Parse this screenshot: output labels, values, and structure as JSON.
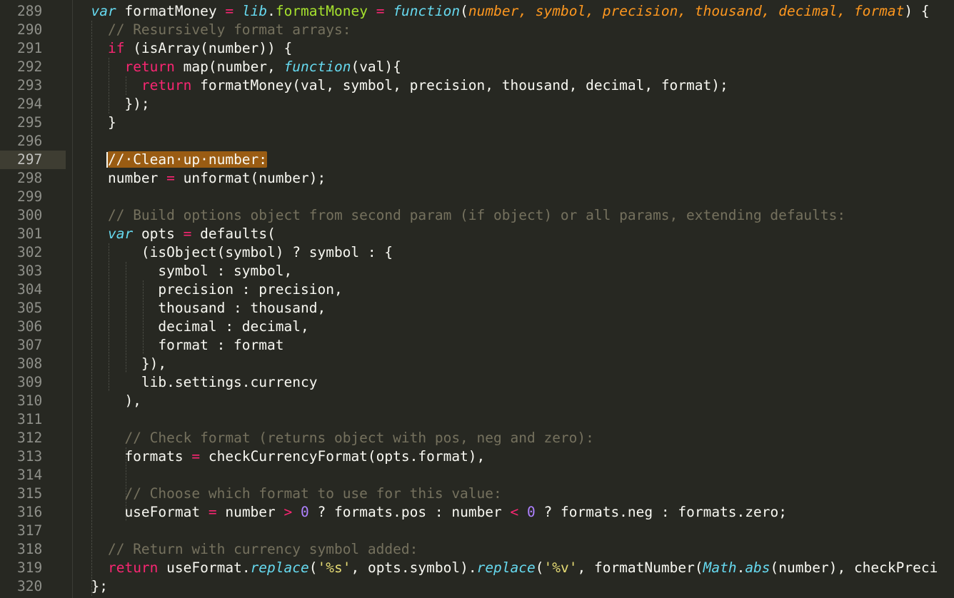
{
  "editor": {
    "active_line": "297",
    "colors": {
      "background": "#272822",
      "gutter_text": "#8f908a",
      "keyword": "#f92672",
      "storage": "#66d9ef",
      "function": "#a6e22e",
      "parameter": "#fd971f",
      "comment": "#75715e",
      "number": "#ae81ff",
      "string": "#e6db74",
      "selection": "#9a5c13"
    }
  },
  "lines": [
    {
      "n": "289",
      "tokens": [
        [
          "",
          "  "
        ],
        [
          "st",
          "var"
        ],
        [
          "",
          " formatMoney "
        ],
        [
          "op",
          "="
        ],
        [
          "",
          " "
        ],
        [
          "st",
          "lib"
        ],
        [
          "",
          "."
        ],
        [
          "fn",
          "formatMoney"
        ],
        [
          "",
          " "
        ],
        [
          "op",
          "="
        ],
        [
          "",
          " "
        ],
        [
          "st",
          "function"
        ],
        [
          "",
          "("
        ],
        [
          "pm",
          "number, symbol, precision, thousand, decimal, format"
        ],
        [
          "",
          ") {"
        ]
      ]
    },
    {
      "n": "290",
      "tokens": [
        [
          "",
          "    "
        ],
        [
          "cm",
          "// Resursively format arrays:"
        ]
      ]
    },
    {
      "n": "291",
      "tokens": [
        [
          "",
          "    "
        ],
        [
          "kw",
          "if"
        ],
        [
          "",
          " (isArray(number)) {"
        ]
      ]
    },
    {
      "n": "292",
      "tokens": [
        [
          "",
          "      "
        ],
        [
          "kw",
          "return"
        ],
        [
          "",
          " map(number, "
        ],
        [
          "st",
          "function"
        ],
        [
          "",
          "(val){"
        ]
      ]
    },
    {
      "n": "293",
      "tokens": [
        [
          "",
          "        "
        ],
        [
          "kw",
          "return"
        ],
        [
          "",
          " formatMoney(val, symbol, precision, thousand, decimal, format);"
        ]
      ]
    },
    {
      "n": "294",
      "tokens": [
        [
          "",
          "      });"
        ]
      ]
    },
    {
      "n": "295",
      "tokens": [
        [
          "",
          "    }"
        ]
      ]
    },
    {
      "n": "296",
      "tokens": []
    },
    {
      "n": "297",
      "tokens": [
        [
          "",
          "    "
        ],
        [
          "hl",
          "//·Clean·up·number:"
        ]
      ]
    },
    {
      "n": "298",
      "tokens": [
        [
          "",
          "    number "
        ],
        [
          "op",
          "="
        ],
        [
          "",
          " unformat(number);"
        ]
      ]
    },
    {
      "n": "299",
      "tokens": []
    },
    {
      "n": "300",
      "tokens": [
        [
          "",
          "    "
        ],
        [
          "cm",
          "// Build options object from second param (if object) or all params, extending defaults:"
        ]
      ]
    },
    {
      "n": "301",
      "tokens": [
        [
          "",
          "    "
        ],
        [
          "st",
          "var"
        ],
        [
          "",
          " opts "
        ],
        [
          "op",
          "="
        ],
        [
          "",
          " defaults("
        ]
      ]
    },
    {
      "n": "302",
      "tokens": [
        [
          "",
          "        (isObject(symbol) ? symbol : {"
        ]
      ]
    },
    {
      "n": "303",
      "tokens": [
        [
          "",
          "          symbol : symbol,"
        ]
      ]
    },
    {
      "n": "304",
      "tokens": [
        [
          "",
          "          precision : precision,"
        ]
      ]
    },
    {
      "n": "305",
      "tokens": [
        [
          "",
          "          thousand : thousand,"
        ]
      ]
    },
    {
      "n": "306",
      "tokens": [
        [
          "",
          "          decimal : decimal,"
        ]
      ]
    },
    {
      "n": "307",
      "tokens": [
        [
          "",
          "          format : format"
        ]
      ]
    },
    {
      "n": "308",
      "tokens": [
        [
          "",
          "        }),"
        ]
      ]
    },
    {
      "n": "309",
      "tokens": [
        [
          "",
          "        lib.settings.currency"
        ]
      ]
    },
    {
      "n": "310",
      "tokens": [
        [
          "",
          "      ),"
        ]
      ]
    },
    {
      "n": "311",
      "tokens": []
    },
    {
      "n": "312",
      "tokens": [
        [
          "",
          "      "
        ],
        [
          "cm",
          "// Check format (returns object with pos, neg and zero):"
        ]
      ]
    },
    {
      "n": "313",
      "tokens": [
        [
          "",
          "      formats "
        ],
        [
          "op",
          "="
        ],
        [
          "",
          " checkCurrencyFormat(opts.format),"
        ]
      ]
    },
    {
      "n": "314",
      "tokens": []
    },
    {
      "n": "315",
      "tokens": [
        [
          "",
          "      "
        ],
        [
          "cm",
          "// Choose which format to use for this value:"
        ]
      ]
    },
    {
      "n": "316",
      "tokens": [
        [
          "",
          "      useFormat "
        ],
        [
          "op",
          "="
        ],
        [
          "",
          " number "
        ],
        [
          "op",
          ">"
        ],
        [
          "",
          " "
        ],
        [
          "nm",
          "0"
        ],
        [
          "",
          " ? formats.pos : number "
        ],
        [
          "op",
          "<"
        ],
        [
          "",
          " "
        ],
        [
          "nm",
          "0"
        ],
        [
          "",
          " ? formats.neg : formats.zero;"
        ]
      ]
    },
    {
      "n": "317",
      "tokens": []
    },
    {
      "n": "318",
      "tokens": [
        [
          "",
          "    "
        ],
        [
          "cm",
          "// Return with currency symbol added:"
        ]
      ]
    },
    {
      "n": "319",
      "tokens": [
        [
          "",
          "    "
        ],
        [
          "kw",
          "return"
        ],
        [
          "",
          " useFormat."
        ],
        [
          "st",
          "replace"
        ],
        [
          "",
          "("
        ],
        [
          "str",
          "'%s'"
        ],
        [
          "",
          ", opts.symbol)."
        ],
        [
          "st",
          "replace"
        ],
        [
          "",
          "("
        ],
        [
          "str",
          "'%v'"
        ],
        [
          "",
          ", formatNumber("
        ],
        [
          "st",
          "Math"
        ],
        [
          "",
          "."
        ],
        [
          "st",
          "abs"
        ],
        [
          "",
          "(number), checkPreci"
        ]
      ]
    },
    {
      "n": "320",
      "tokens": [
        [
          "",
          "  };"
        ]
      ]
    }
  ]
}
